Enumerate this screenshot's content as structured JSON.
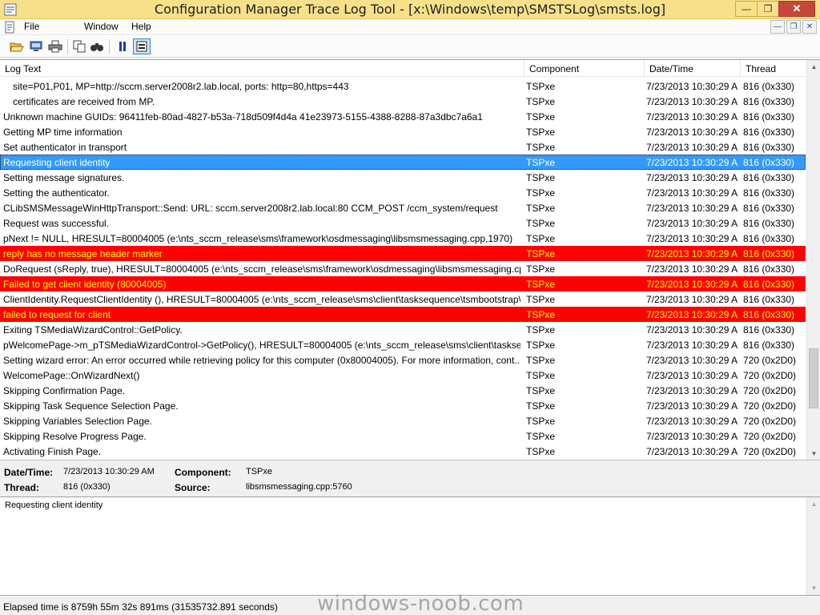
{
  "window": {
    "title": "Configuration Manager Trace Log Tool - [x:\\Windows\\temp\\SMSTSLog\\smsts.log]",
    "minimize": "—",
    "maximize": "❐",
    "close": "✕"
  },
  "menu": {
    "items": [
      "File",
      "Window",
      "Help"
    ],
    "mdi_minimize": "—",
    "mdi_restore": "❐",
    "mdi_close": "✕"
  },
  "toolbar": {
    "buttons": [
      "open-icon",
      "open-server-icon",
      "print-icon",
      "copy-icon",
      "find-icon",
      "pause-icon",
      "highlight-icon"
    ]
  },
  "log": {
    "columns": [
      "Log Text",
      "Component",
      "Date/Time",
      "Thread"
    ],
    "rows": [
      {
        "text": "site=P01,P01, MP=http://sccm.server2008r2.lab.local, ports: http=80,https=443",
        "component": "TSPxe",
        "datetime": "7/23/2013 10:30:29 AM",
        "thread": "816 (0x330)",
        "state": "normal",
        "indent": true
      },
      {
        "text": "certificates are received from MP.",
        "component": "TSPxe",
        "datetime": "7/23/2013 10:30:29 AM",
        "thread": "816 (0x330)",
        "state": "normal",
        "indent": true
      },
      {
        "text": "Unknown machine GUIDs: 96411feb-80ad-4827-b53a-718d509f4d4a 41e23973-5155-4388-8288-87a3dbc7a6a1",
        "component": "TSPxe",
        "datetime": "7/23/2013 10:30:29 AM",
        "thread": "816 (0x330)",
        "state": "normal"
      },
      {
        "text": "Getting MP time information",
        "component": "TSPxe",
        "datetime": "7/23/2013 10:30:29 AM",
        "thread": "816 (0x330)",
        "state": "normal"
      },
      {
        "text": "Set authenticator in transport",
        "component": "TSPxe",
        "datetime": "7/23/2013 10:30:29 AM",
        "thread": "816 (0x330)",
        "state": "normal"
      },
      {
        "text": "Requesting client identity",
        "component": "TSPxe",
        "datetime": "7/23/2013 10:30:29 AM",
        "thread": "816 (0x330)",
        "state": "selected"
      },
      {
        "text": "Setting message signatures.",
        "component": "TSPxe",
        "datetime": "7/23/2013 10:30:29 AM",
        "thread": "816 (0x330)",
        "state": "normal"
      },
      {
        "text": "Setting the authenticator.",
        "component": "TSPxe",
        "datetime": "7/23/2013 10:30:29 AM",
        "thread": "816 (0x330)",
        "state": "normal"
      },
      {
        "text": "CLibSMSMessageWinHttpTransport::Send: URL: sccm.server2008r2.lab.local:80  CCM_POST /ccm_system/request",
        "component": "TSPxe",
        "datetime": "7/23/2013 10:30:29 AM",
        "thread": "816 (0x330)",
        "state": "normal"
      },
      {
        "text": "Request was successful.",
        "component": "TSPxe",
        "datetime": "7/23/2013 10:30:29 AM",
        "thread": "816 (0x330)",
        "state": "normal"
      },
      {
        "text": "pNext != NULL, HRESULT=80004005 (e:\\nts_sccm_release\\sms\\framework\\osdmessaging\\libsmsmessaging.cpp,1970)",
        "component": "TSPxe",
        "datetime": "7/23/2013 10:30:29 AM",
        "thread": "816 (0x330)",
        "state": "normal"
      },
      {
        "text": "reply has no message header marker",
        "component": "TSPxe",
        "datetime": "7/23/2013 10:30:29 AM",
        "thread": "816 (0x330)",
        "state": "error"
      },
      {
        "text": "DoRequest (sReply, true), HRESULT=80004005 (e:\\nts_sccm_release\\sms\\framework\\osdmessaging\\libsmsmessaging.cp...",
        "component": "TSPxe",
        "datetime": "7/23/2013 10:30:29 AM",
        "thread": "816 (0x330)",
        "state": "normal"
      },
      {
        "text": "Failed to get client identity (80004005)",
        "component": "TSPxe",
        "datetime": "7/23/2013 10:30:29 AM",
        "thread": "816 (0x330)",
        "state": "error"
      },
      {
        "text": "ClientIdentity.RequestClientIdentity (), HRESULT=80004005 (e:\\nts_sccm_release\\sms\\client\\tasksequence\\tsmbootstrap\\...",
        "component": "TSPxe",
        "datetime": "7/23/2013 10:30:29 AM",
        "thread": "816 (0x330)",
        "state": "normal"
      },
      {
        "text": "failed to request for client",
        "component": "TSPxe",
        "datetime": "7/23/2013 10:30:29 AM",
        "thread": "816 (0x330)",
        "state": "error"
      },
      {
        "text": "Exiting TSMediaWizardControl::GetPolicy.",
        "component": "TSPxe",
        "datetime": "7/23/2013 10:30:29 AM",
        "thread": "816 (0x330)",
        "state": "normal"
      },
      {
        "text": "pWelcomePage->m_pTSMediaWizardControl->GetPolicy(), HRESULT=80004005 (e:\\nts_sccm_release\\sms\\client\\taskseq...",
        "component": "TSPxe",
        "datetime": "7/23/2013 10:30:29 AM",
        "thread": "816 (0x330)",
        "state": "normal"
      },
      {
        "text": "Setting wizard error: An error occurred while retrieving policy for this computer  (0x80004005). For more information, cont...",
        "component": "TSPxe",
        "datetime": "7/23/2013 10:30:29 AM",
        "thread": "720 (0x2D0)",
        "state": "normal"
      },
      {
        "text": "WelcomePage::OnWizardNext()",
        "component": "TSPxe",
        "datetime": "7/23/2013 10:30:29 AM",
        "thread": "720 (0x2D0)",
        "state": "normal"
      },
      {
        "text": "Skipping Confirmation Page.",
        "component": "TSPxe",
        "datetime": "7/23/2013 10:30:29 AM",
        "thread": "720 (0x2D0)",
        "state": "normal"
      },
      {
        "text": "Skipping Task Sequence Selection Page.",
        "component": "TSPxe",
        "datetime": "7/23/2013 10:30:29 AM",
        "thread": "720 (0x2D0)",
        "state": "normal"
      },
      {
        "text": "Skipping Variables Selection Page.",
        "component": "TSPxe",
        "datetime": "7/23/2013 10:30:29 AM",
        "thread": "720 (0x2D0)",
        "state": "normal"
      },
      {
        "text": "Skipping Resolve Progress Page.",
        "component": "TSPxe",
        "datetime": "7/23/2013 10:30:29 AM",
        "thread": "720 (0x2D0)",
        "state": "normal"
      },
      {
        "text": "Activating Finish Page.",
        "component": "TSPxe",
        "datetime": "7/23/2013 10:30:29 AM",
        "thread": "720 (0x2D0)",
        "state": "normal"
      }
    ]
  },
  "details": {
    "datetime_label": "Date/Time:",
    "datetime_value": "7/23/2013 10:30:29 AM",
    "component_label": "Component:",
    "component_value": "TSPxe",
    "thread_label": "Thread:",
    "thread_value": "816 (0x330)",
    "source_label": "Source:",
    "source_value": "libsmsmessaging.cpp:5760"
  },
  "message": {
    "text": "Requesting client identity"
  },
  "status": {
    "text": "Elapsed time is 8759h 55m 32s 891ms (31535732.891 seconds)"
  },
  "watermark": "windows-noob.com",
  "colors": {
    "title_bar": "#f6e08a",
    "error_row_bg": "#ff0000",
    "error_row_text": "#ffff00",
    "selected_row_bg": "#3399ff"
  }
}
